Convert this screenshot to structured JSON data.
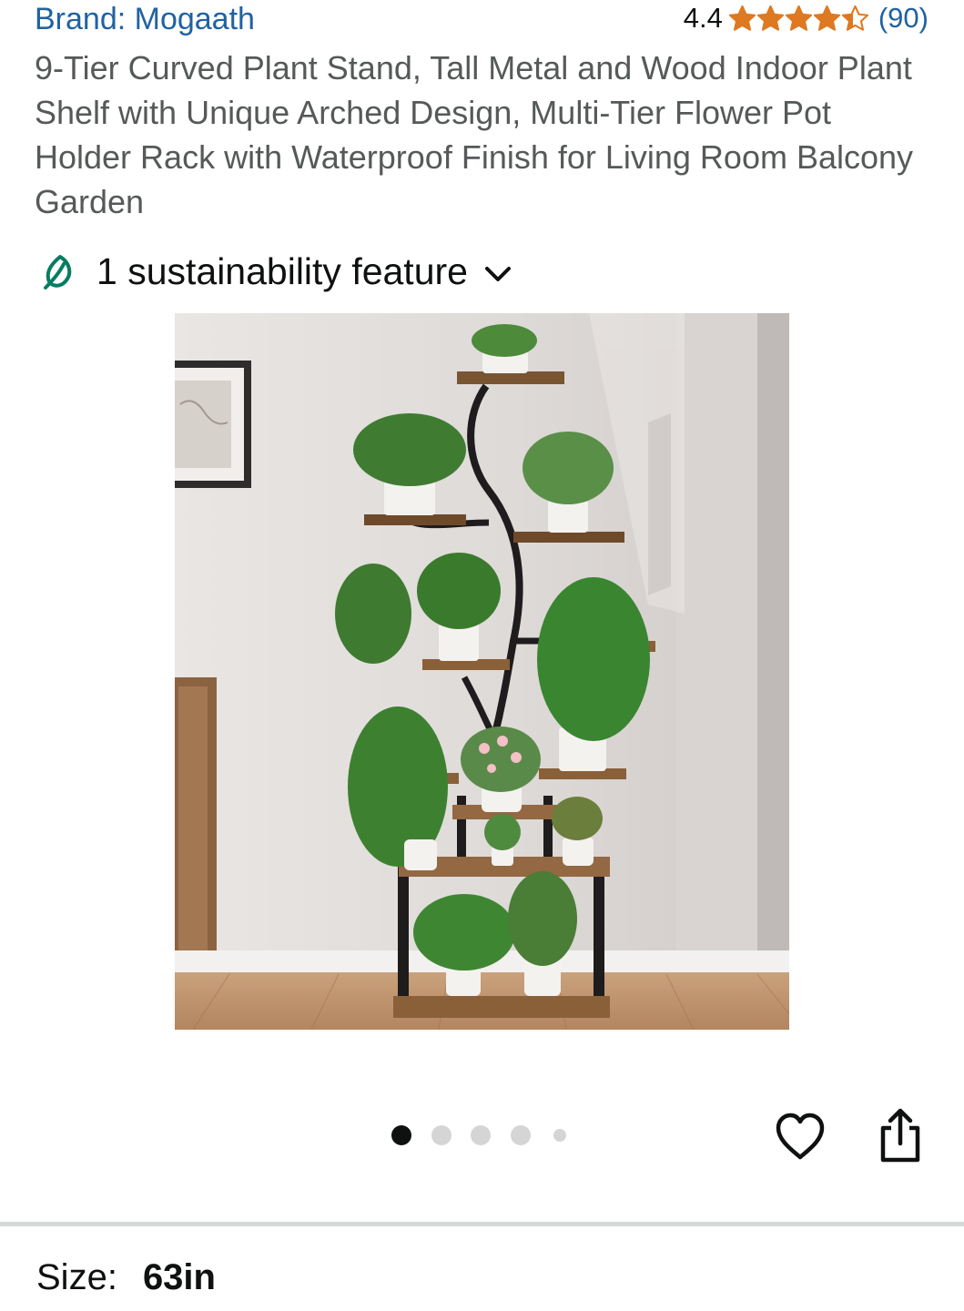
{
  "product": {
    "brand_label": "Brand: Mogaath",
    "rating_value": "4.4",
    "rating_stars": 4.4,
    "review_count": "(90)",
    "title": "9-Tier Curved Plant Stand, Tall Metal and Wood Indoor Plant Shelf with Unique Arched Design, Multi-Tier Flower Pot Holder Rack with Waterproof Finish for Living Room Balcony Garden"
  },
  "sustainability": {
    "label": "1 sustainability feature",
    "icon": "leaf-icon",
    "expand_icon": "chevron-down-icon"
  },
  "gallery": {
    "image_count": 5,
    "active_index": 0,
    "favorite_icon": "heart-icon",
    "share_icon": "share-icon"
  },
  "size": {
    "label": "Size:",
    "value": "63in"
  },
  "colors": {
    "link": "#2162a1",
    "star": "#de7921",
    "leaf": "#067d62",
    "title_text": "#565959"
  }
}
